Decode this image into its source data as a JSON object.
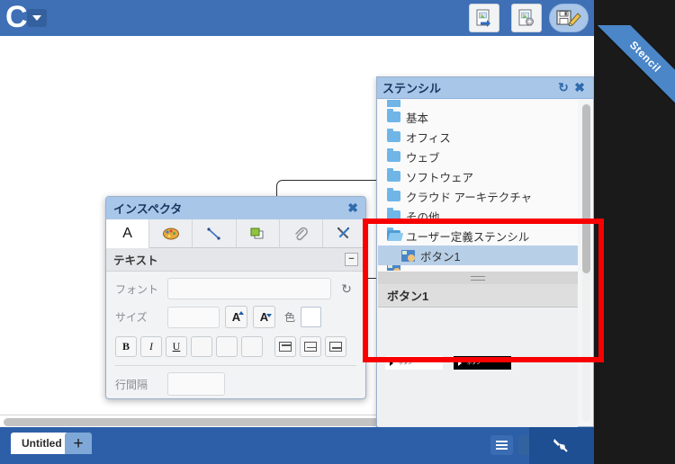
{
  "app": {
    "logo_letter": "C",
    "logo_dropdown_icon": "caret-down-icon"
  },
  "toolbar": {
    "buttons": [
      {
        "name": "export-image-button",
        "icon": "image-export-icon",
        "label": ""
      },
      {
        "name": "image-settings-button",
        "icon": "image-gear-icon",
        "label": ""
      },
      {
        "name": "save-edit-button",
        "icon": "floppy-pencil-icon",
        "label": ""
      }
    ]
  },
  "ribbon": {
    "label": "Stencil"
  },
  "stencil_panel": {
    "title": "ステンシル",
    "refresh_icon": "refresh-icon",
    "close_icon": "close-icon",
    "tree": [
      {
        "label": "基本",
        "type": "folder",
        "selected": false
      },
      {
        "label": "オフィス",
        "type": "folder",
        "selected": false
      },
      {
        "label": "ウェブ",
        "type": "folder",
        "selected": false
      },
      {
        "label": "ソフトウェア",
        "type": "folder",
        "selected": false
      },
      {
        "label": "クラウド アーキテクチャ",
        "type": "folder",
        "selected": false
      },
      {
        "label": "その他",
        "type": "folder",
        "selected": false
      },
      {
        "label": "ユーザー定義ステンシル",
        "type": "folder-open",
        "selected": false
      },
      {
        "label": "ボタン1",
        "type": "shape",
        "selected": true
      }
    ],
    "preview": {
      "title": "ボタン1",
      "items": [
        {
          "label": "ボタン",
          "style": "light"
        },
        {
          "label": "ボタン",
          "style": "dark"
        }
      ]
    }
  },
  "inspector": {
    "title": "インスペクタ",
    "close_icon": "close-icon",
    "tabs": [
      {
        "name": "tab-text",
        "icon": "letter-a-icon",
        "label": "A",
        "active": true
      },
      {
        "name": "tab-fill",
        "icon": "palette-icon",
        "label": "",
        "active": false
      },
      {
        "name": "tab-line",
        "icon": "line-icon",
        "label": "",
        "active": false
      },
      {
        "name": "tab-shape",
        "icon": "shape-icon",
        "label": "",
        "active": false
      },
      {
        "name": "tab-link",
        "icon": "paperclip-icon",
        "label": "",
        "active": false
      },
      {
        "name": "tab-tools",
        "icon": "tools-icon",
        "label": "",
        "active": false
      }
    ],
    "section": {
      "title": "テキスト",
      "collapse_icon": "−"
    },
    "font": {
      "label": "フォント",
      "value": "",
      "placeholder": "",
      "refresh_icon": "refresh-icon"
    },
    "size": {
      "label": "サイズ",
      "value": "",
      "placeholder": "",
      "increase_label": "A",
      "decrease_label": "A",
      "color_label": "色",
      "color_value": "#ffffff"
    },
    "format": {
      "bold": "B",
      "italic": "I",
      "underline": "U",
      "align_left": "align-left-icon",
      "align_center": "align-center-icon",
      "align_right": "align-right-icon",
      "valign_top": "valign-top-icon",
      "valign_middle": "valign-middle-icon",
      "valign_bottom": "valign-bottom-icon"
    },
    "line_spacing": {
      "label": "行間隔",
      "value": "",
      "placeholder": ""
    }
  },
  "bottombar": {
    "document_tab": "Untitled",
    "add_tab_label": "+",
    "menu_icon": "hamburger-icon",
    "pen_icon": "pen-icon"
  },
  "annotation": {
    "color": "#f80000"
  }
}
